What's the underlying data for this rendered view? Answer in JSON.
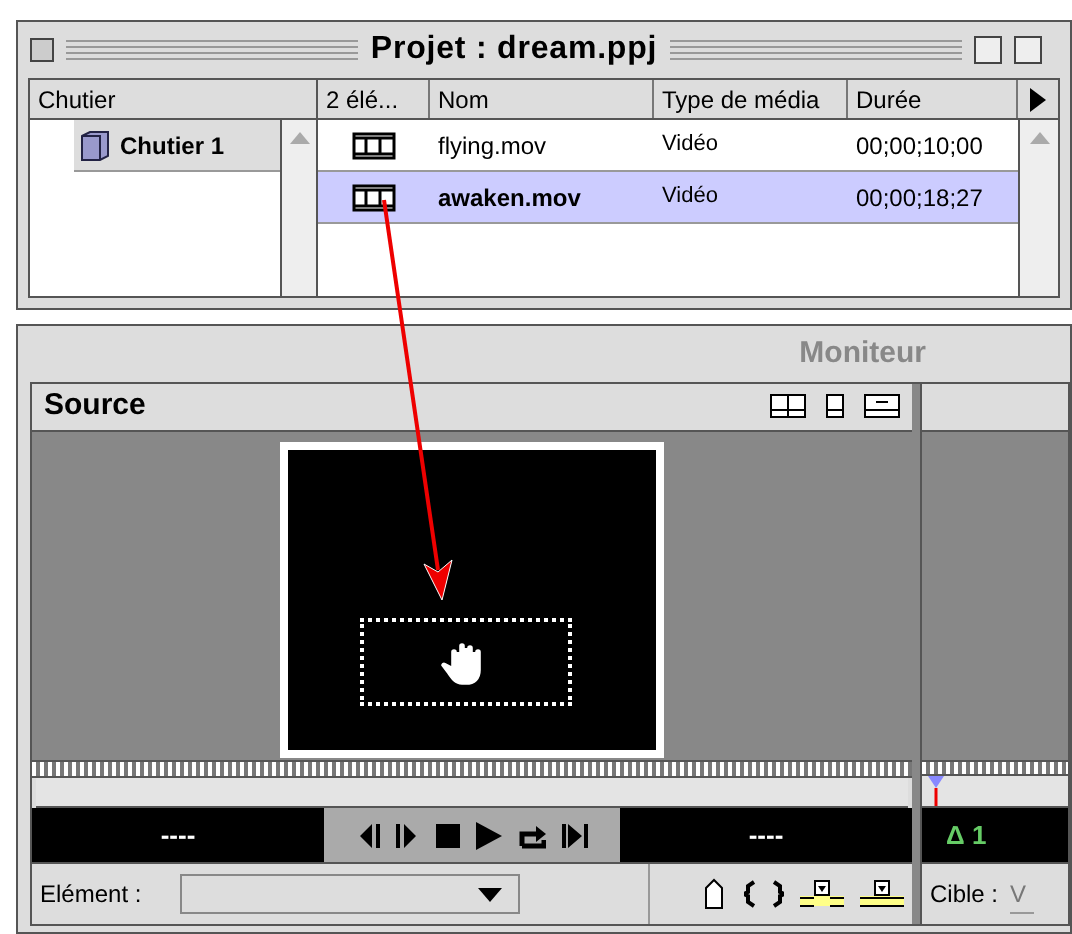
{
  "project_window": {
    "title": "Projet : dream.ppj",
    "bin_header": "Chutier",
    "bins": [
      {
        "label": "Chutier 1",
        "selected": true
      }
    ],
    "columns": [
      "2 élé...",
      "Nom",
      "Type de média",
      "Durée"
    ],
    "clips": [
      {
        "name": "flying.mov",
        "media_type": "Vidéo",
        "duration": "00;00;10;00",
        "selected": false
      },
      {
        "name": "awaken.mov",
        "media_type": "Vidéo",
        "duration": "00;00;18;27",
        "selected": true
      }
    ]
  },
  "monitor": {
    "title": "Moniteur",
    "source": {
      "title": "Source",
      "timecode_left": "----",
      "timecode_right": "----",
      "element_label": "Elément :"
    },
    "program": {
      "timecode": "Δ 1",
      "target_label": "Cible :",
      "target_value": "V"
    }
  }
}
